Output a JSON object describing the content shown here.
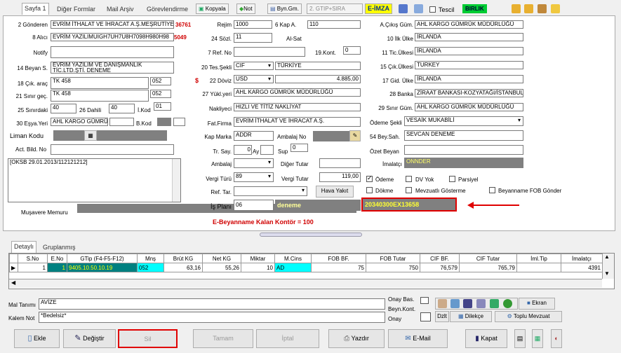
{
  "tabs": [
    "Sayfa 1",
    "Diğer Formlar",
    "Mail Arşiv",
    "Görevlendirme"
  ],
  "toolbar": {
    "kopyala": "Kopyala",
    "not": "Not",
    "byn_gm": "Byn.Gm.",
    "gtip": "2. GTIP+SIRA",
    "eimza": "E-İMZA",
    "tescil": "Tescil",
    "birlik": "BIRLIK"
  },
  "left": {
    "gonderen_label": "2 Gönderen",
    "gonderen": "EVRİM İTHALAT VE İHRACAT A.Ş.MEŞRUTİYET",
    "gonderen_code": "36761",
    "alici_label": "8 Alıcı",
    "alici": "EVRİM YAZILIMUIGH7UH7U8H7098H980H98",
    "alici_code": "5049",
    "notify_label": "Notify",
    "beyan_label": "14 Beyan S.",
    "beyan": "EVRİM YAZILIM VE DANIŞMANLIK TİC.LTD.ŞTİ. DENEME",
    "cik_arac_label": "18 Çık. araç",
    "cik_arac": "TK 458",
    "cik_arac_code": "052",
    "sinir_gec_label": "21 Sınır geç.",
    "sinir_gec": "TK 458",
    "sinir_gec_code": "052",
    "sinirdaki_label": "25 Sınırdaki",
    "sinirdaki": "40",
    "dahili_label": "26 Dahili",
    "dahili": "40",
    "ikod_label": "İ.Kod",
    "ikod": "01",
    "esya_yeri_label": "30 Eşya.Yeri",
    "esya_yeri": "AHL KARGO GÜMRÜ",
    "bkod_label": "B.Kod",
    "liman_label": "Liman Kodu",
    "act_bild_label": "Act. Bild. No",
    "memo": "[OKSB 29.01.2013/112121212]",
    "musavir_label": "Muşavere Memuru"
  },
  "mid": {
    "rejim_label": "Rejim",
    "rejim": "1000",
    "kap_a_label": "6 Kap A.",
    "kap_a": "110",
    "sozl_label": "24 Sözl.",
    "sozl": "11",
    "alsat_label": "Al-Sat",
    "ref_label": "7 Ref. No",
    "kont_label": "19.Kont.",
    "kont": "0",
    "tes_sekli_label": "20 Tes.Şekli",
    "tes_sekli": "CIF",
    "tes_ulke": "TÜRKİYE",
    "doviz_label": "22 Döviz",
    "doviz": "USD",
    "doviz_tutar": "4.885,00",
    "yukl_label": "27 Yükl.yeri",
    "yukl": "AHL KARGO GÜMRÜK MÜDÜRLÜĞÜ",
    "nakliyeci_label": "Nakliyeci",
    "nakliyeci": "HIZLI VE TİTİZ NAKLİYAT",
    "fat_firma_label": "Fat.Firma",
    "fat_firma": "EVRİM İTHALAT VE İHRACAT A.Ş.",
    "kap_marka_label": "Kap Marka",
    "kap_marka": "ADDR",
    "ambalaj_no_label": "Ambalaj No",
    "tr_say_label": "Tr. Say.",
    "tr_say": "0",
    "ay_label": "Ay",
    "sup_label": "Sup",
    "sup": "0",
    "ambalaj_label": "Ambalaj",
    "diger_tutar_label": "Diğer Tutar",
    "vergi_turu_label": "Vergi Türü",
    "vergi_turu": "89",
    "vergi_tutar_label": "Vergi Tutar",
    "vergi_tutar": "119,00",
    "ref_tar_label": "Ref. Tar.",
    "hava_yakit": "Hava Yakıt",
    "is_plani_label": "İş Planı",
    "is_plani": "06",
    "is_plani_text": "deneme",
    "ref_code": "20340300EX13658",
    "kontor": "E-Beyanname Kalan Kontör = 100"
  },
  "right": {
    "cikis_gum_label": "A.Çıkış Güm.",
    "cikis_gum": "AHL KARGO GÜMRÜK MÜDÜRLÜĞÜ",
    "ilk_ulke_label": "10 İlk Ülke",
    "ilk_ulke": "İRLANDA",
    "tic_ulke_label": "11 Tic.Ülkesi",
    "tic_ulke": "İRLANDA",
    "cik_ulke_label": "15 Çık.Ülkesi",
    "cik_ulke": "TURKEY",
    "gid_ulke_label": "17 Gid. Ülke",
    "gid_ulke": "İRLANDA",
    "banka_label": "28 Banka",
    "banka": "ZİRAAT BANKASI-KOZYATAĞI/İSTANBUL",
    "sinir_gum_label": "29 Sınır Güm.",
    "sinir_gum": "AHL KARGO GÜMRÜK MÜDÜRLÜĞÜ",
    "odeme_sekli_label": "Ödeme Şekli",
    "odeme_sekli": "VESAİK MUKABİLİ",
    "beyan_sah_label": "54 Bey.Sah.",
    "beyan_sah": "SEVCAN DENEME",
    "ozet_label": "Özet Beyan",
    "imalatci_label": "İmalatçı",
    "imalatci": "ONNDER",
    "odeme": "Ödeme",
    "dv_yok": "DV Yok",
    "parsiyel": "Parsiyel",
    "dokme": "Dökme",
    "mevzuat": "Mevzuatlı Gösterme",
    "fob": "Beyanname FOB Gönder"
  },
  "detail_tabs": [
    "Detaylı",
    "Gruplanmış"
  ],
  "grid": {
    "headers": [
      "S.No",
      "E.No",
      "GTip (F4-F5-F12)",
      "Mnş",
      "Brüt KG",
      "Net KG",
      "Miktar",
      "M.Cins",
      "FOB BF.",
      "FOB Tutar",
      "CIF BF.",
      "CIF Tutar",
      "İml.Tip",
      "İmalatçı"
    ],
    "row": [
      "1",
      "1",
      "9405.10.50.10.19",
      "052",
      "63,16",
      "55,26",
      "10",
      "AD",
      "75",
      "750",
      "76,579",
      "765,79",
      "",
      "4391"
    ]
  },
  "bottom": {
    "mal_tanimi_label": "Mal Tanımı",
    "mal_tanimi": "AVİZE",
    "kalem_not_label": "Kalem Not",
    "kalem_not": "*Bedelsiz*",
    "onay_bas": "Onay Bas.",
    "beyn_kont": "Beyn.Kont.",
    "onay": "Onay",
    "dzlt": "Dzlt",
    "dilekce": "Dilekçe",
    "ekran": "Ekran",
    "toplu": "Toplu Mevzuat"
  },
  "buttons": {
    "ekle": "Ekle",
    "degistir": "Değiştir",
    "sil": "Sil",
    "tamam": "Tamam",
    "iptal": "İptal",
    "yazdir": "Yazdır",
    "email": "E-Mail",
    "kapat": "Kapat"
  }
}
